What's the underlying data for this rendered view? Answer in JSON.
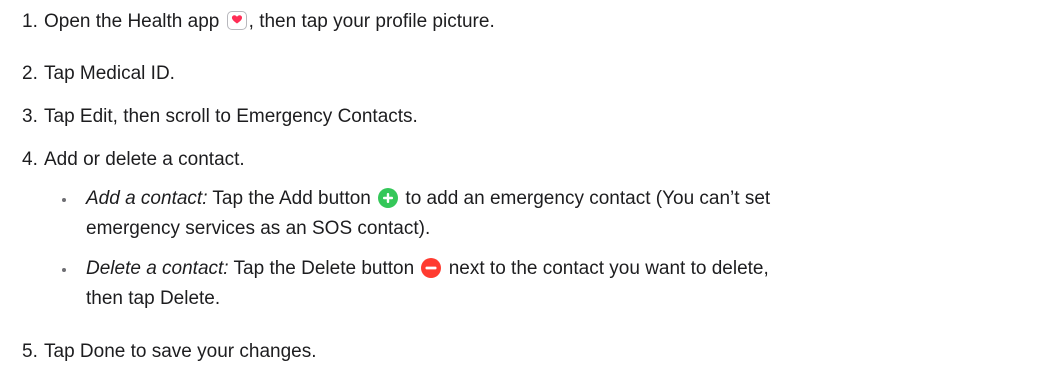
{
  "steps": [
    {
      "num": "1.",
      "text_before": "Open the Health app",
      "icon": "health-app-icon",
      "text_after": ", then tap your profile picture."
    },
    {
      "num": "2.",
      "text": "Tap Medical ID."
    },
    {
      "num": "3.",
      "text": "Tap Edit, then scroll to Emergency Contacts."
    },
    {
      "num": "4.",
      "text": "Add or delete a contact."
    },
    {
      "num": "5.",
      "text": "Tap Done to save your changes."
    }
  ],
  "substeps": [
    {
      "label": "Add a contact:",
      "text_before": " Tap the Add button",
      "icon": "add-circle-icon",
      "text_after_line1": " to add an emergency contact (You can’t set",
      "line2": "emergency services as an SOS contact)."
    },
    {
      "label": "Delete a contact:",
      "text_before": " Tap the Delete button",
      "icon": "delete-circle-icon",
      "text_after_line1": " next to the contact you want to delete,",
      "line2": "then tap Delete."
    }
  ],
  "colors": {
    "text": "#1d1d1f",
    "add_green": "#34c759",
    "delete_red": "#ff3b30",
    "heart_pink": "#ff2d55"
  }
}
